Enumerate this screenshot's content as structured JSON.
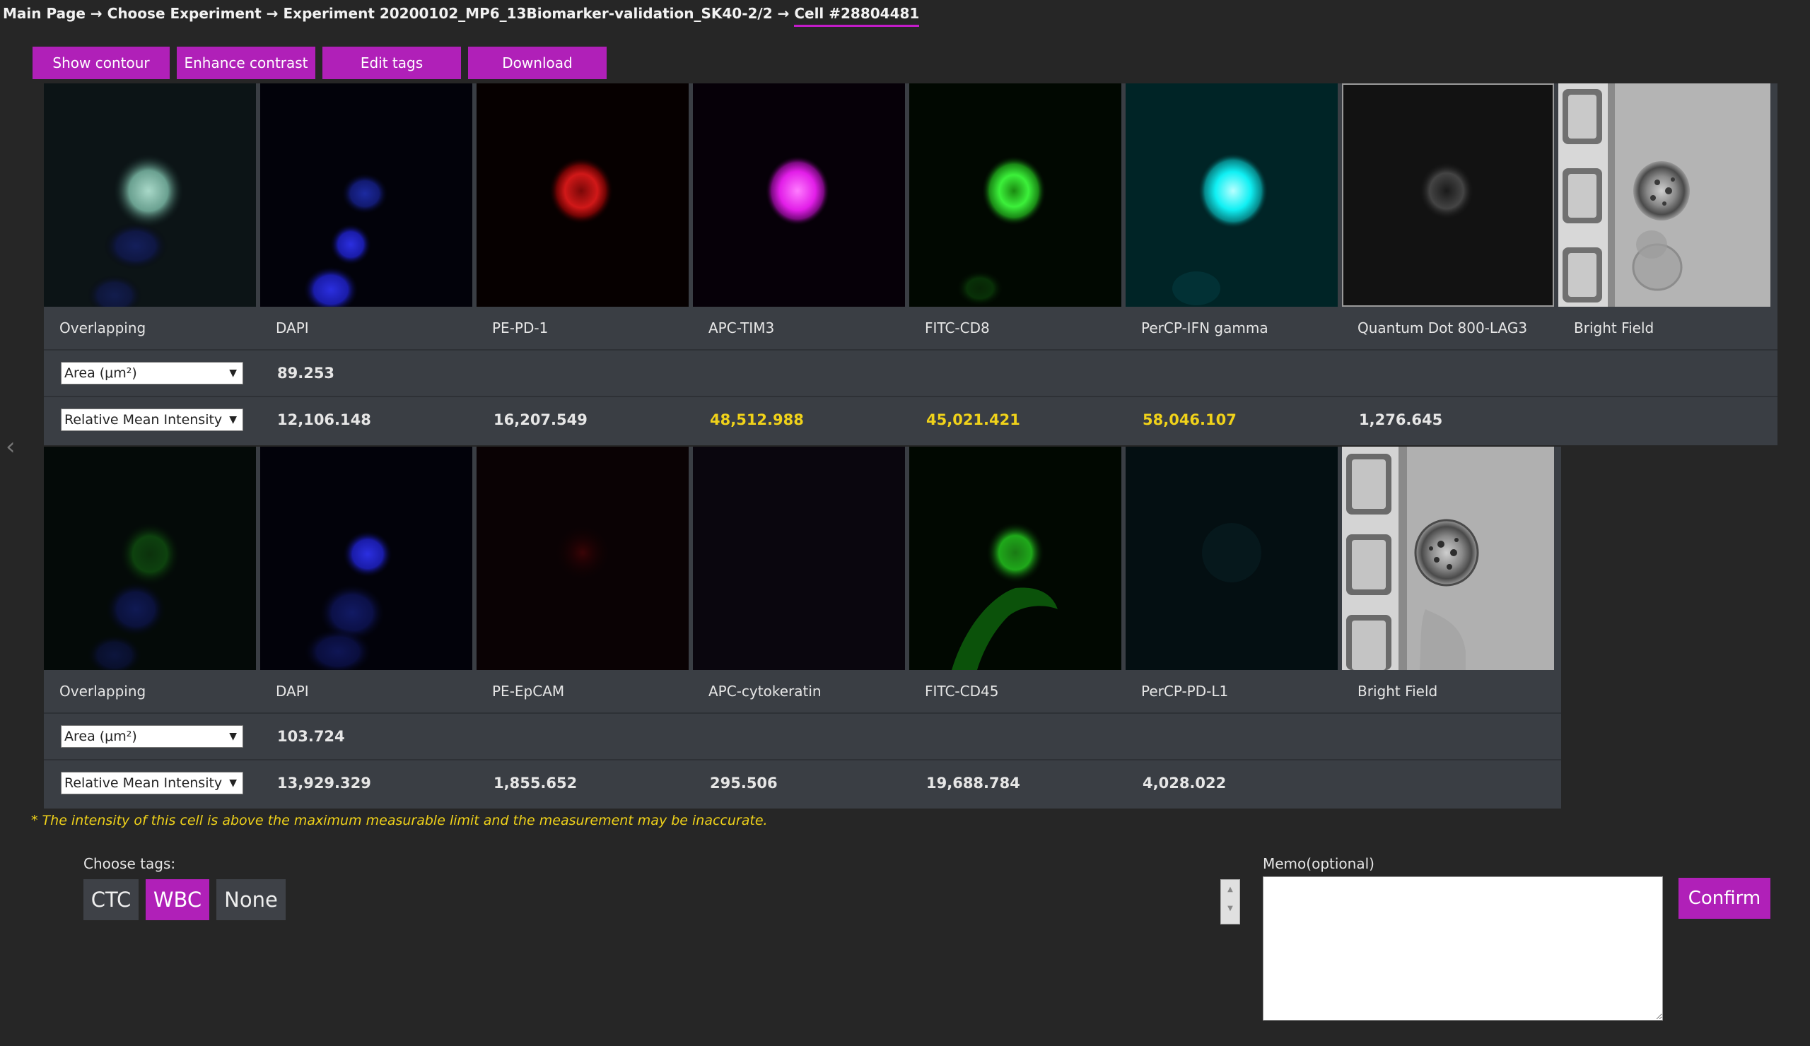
{
  "breadcrumb": {
    "path": "Main Page → Choose Experiment → Experiment 20200102_MP6_13Biomarker-validation_SK40-2/2 → ",
    "current": "Cell #28804481"
  },
  "toolbar": {
    "show_contour": "Show contour",
    "enhance_contrast": "Enhance contrast",
    "edit_tags": "Edit tags",
    "download": "Download"
  },
  "colors": {
    "accent": "#b020b8",
    "highlight": "#f0d21a",
    "panel": "#3a3e44",
    "background": "#262626"
  },
  "top_row": {
    "area_select": "Area (μm²)",
    "intensity_select": "Relative Mean Intensity",
    "channels": [
      {
        "label": "Overlapping",
        "area": "",
        "intensity": ""
      },
      {
        "label": "DAPI",
        "area": "89.253",
        "intensity": "12,106.148"
      },
      {
        "label": "PE-PD-1",
        "area": "",
        "intensity": "16,207.549"
      },
      {
        "label": "APC-TIM3",
        "area": "",
        "intensity": "48,512.988"
      },
      {
        "label": "FITC-CD8",
        "area": "",
        "intensity": "45,021.421"
      },
      {
        "label": "PerCP-IFN gamma",
        "area": "",
        "intensity": "58,046.107"
      },
      {
        "label": "Quantum Dot 800-LAG3",
        "area": "",
        "intensity": "1,276.645"
      },
      {
        "label": "Bright Field",
        "area": "",
        "intensity": ""
      }
    ]
  },
  "bottom_row": {
    "area_select": "Area (μm²)",
    "intensity_select": "Relative Mean Intensity",
    "channels": [
      {
        "label": "Overlapping",
        "area": "",
        "intensity": ""
      },
      {
        "label": "DAPI",
        "area": "103.724",
        "intensity": "13,929.329"
      },
      {
        "label": "PE-EpCAM",
        "area": "",
        "intensity": "1,855.652"
      },
      {
        "label": "APC-cytokeratin",
        "area": "",
        "intensity": "295.506"
      },
      {
        "label": "FITC-CD45",
        "area": "",
        "intensity": "19,688.784"
      },
      {
        "label": "PerCP-PD-L1",
        "area": "",
        "intensity": "4,028.022"
      },
      {
        "label": "Bright Field",
        "area": "",
        "intensity": ""
      }
    ]
  },
  "footnote": "* The intensity of this cell is above the maximum measurable limit and the measurement may be inaccurate.",
  "tags": {
    "label": "Choose tags:",
    "items": [
      "CTC",
      "WBC",
      "None"
    ],
    "selected": "WBC"
  },
  "memo": {
    "label": "Memo(optional)",
    "value": ""
  },
  "confirm": "Confirm"
}
